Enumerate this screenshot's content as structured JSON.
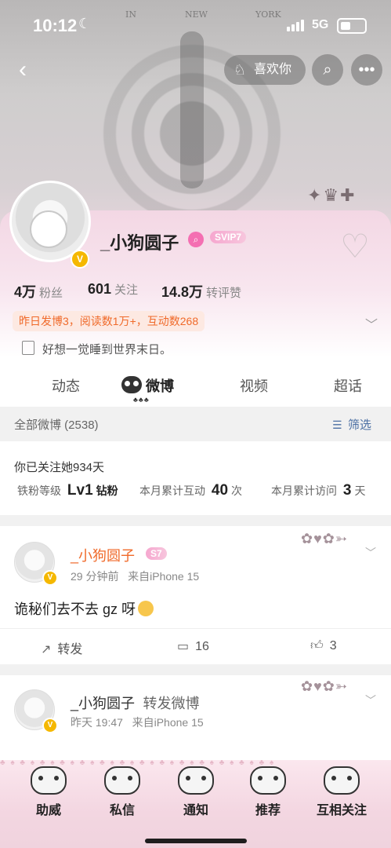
{
  "status_bar": {
    "time": "10:12",
    "network": "5G"
  },
  "header": {
    "back_icon": "chevron-left-icon",
    "like_button": {
      "icon": "fox-icon",
      "label": "喜欢你"
    },
    "search_icon": "search-icon",
    "more_icon": "more-dots-icon",
    "cover_letters": [
      "IN",
      "NEW",
      "YORK"
    ]
  },
  "profile": {
    "username": "_小狗圆子",
    "vip_badge": "SVIP7",
    "stats": [
      {
        "value": "4万",
        "label": "粉丝"
      },
      {
        "value": "601",
        "label": "关注"
      },
      {
        "value": "14.8万",
        "label": "转评赞"
      }
    ],
    "activity": "昨日发博3，阅读数1万+，互动数268",
    "bio": "好想一觉睡到世界末日。"
  },
  "tabs": [
    {
      "label": "动态"
    },
    {
      "label": "微博"
    },
    {
      "label": "视频"
    },
    {
      "label": "超话"
    }
  ],
  "filter": {
    "all_label": "全部微博 (2538)",
    "filter_label": "筛选"
  },
  "fan_info": {
    "follow_days": "你已关注她934天",
    "level_label": "铁粉等级",
    "level_value": "Lv1",
    "level_suffix": "钻粉",
    "interact_label": "本月累计互动",
    "interact_value": "40",
    "interact_unit": "次",
    "visit_label": "本月累计访问",
    "visit_value": "3",
    "visit_unit": "天"
  },
  "posts": [
    {
      "name": "_小狗圆子",
      "badge": "S7",
      "meta": "29 分钟前   来自iPhone 15",
      "text": "诡秘们去不去 gz 呀",
      "repost_label": "转发",
      "comments": "16",
      "likes": "3"
    },
    {
      "name": "_小狗圆子",
      "action": "转发微博",
      "meta": "昨天 19:47   来自iPhone 15"
    }
  ],
  "bottom_bar": [
    {
      "label": "助威"
    },
    {
      "label": "私信"
    },
    {
      "label": "通知"
    },
    {
      "label": "推荐"
    },
    {
      "label": "互相关注"
    }
  ]
}
